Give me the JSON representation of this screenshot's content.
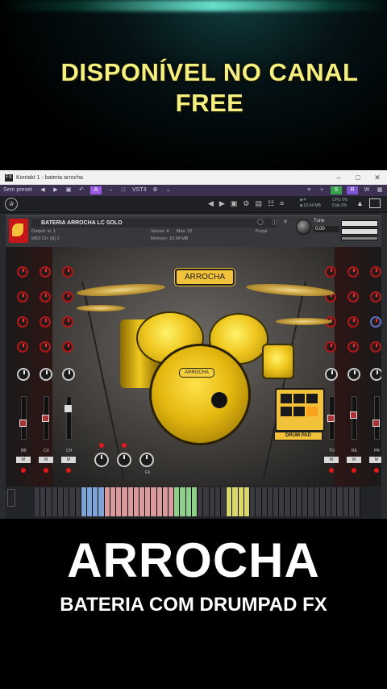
{
  "promo": {
    "line1": "DISPONÍVEL NO CANAL",
    "line2": "FREE"
  },
  "window": {
    "app_icon": "FX",
    "title": "Kontakt 1 - bateria arrocha",
    "controls": [
      "minimize-icon",
      "maximize-icon",
      "close-icon"
    ]
  },
  "toolbar": {
    "preset": "Sem preset",
    "vst": "VST3",
    "badges": [
      "S",
      "R",
      "W"
    ]
  },
  "kontakt": {
    "memory_top": "10.94 MB",
    "voices_top": "4",
    "cpu_label": "CPU",
    "cpu_value": "0%",
    "disk_label": "Disk",
    "disk_value": "0%"
  },
  "instrument": {
    "name": "BATERIA ARROCHA LC SOLO",
    "output_label": "Output:",
    "output_value": "st. 1",
    "midi_label": "MIDI Ch:",
    "midi_value": "[A] 1",
    "voices_label": "Voices:",
    "voices_value": "4",
    "max_label": "Max:",
    "max_value": "32",
    "memory_label": "Memory:",
    "memory_value": "10.94 MB",
    "purge": "Purge",
    "tune_label": "Tune",
    "tune_value": "0.00",
    "tune_level": 0.0
  },
  "stage": {
    "tag": "ARROCHA",
    "kick_logo": "ARROCHA",
    "drumpad_label": "DRUM PAD",
    "fx_label": "FX",
    "mixer_left": [
      "BB",
      "CX",
      "CH"
    ],
    "mixer_right": [
      "TO",
      "RE",
      "PR"
    ],
    "mixer_button": "M"
  },
  "big_title": "ARROCHA",
  "subtitle": "BATERIA COM DRUMPAD FX"
}
